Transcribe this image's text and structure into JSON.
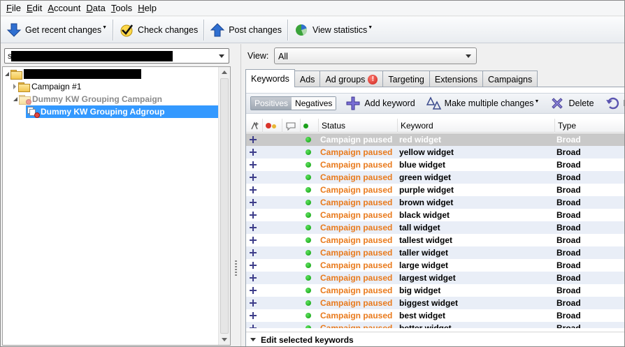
{
  "menu": [
    {
      "key": "F",
      "rest": "ile"
    },
    {
      "key": "E",
      "rest": "dit"
    },
    {
      "key": "A",
      "rest": "ccount"
    },
    {
      "key": "D",
      "rest": "ata"
    },
    {
      "key": "T",
      "rest": "ools"
    },
    {
      "key": "H",
      "rest": "elp"
    }
  ],
  "toolbar": {
    "get_recent": "Get recent changes",
    "check": "Check changes",
    "post": "Post changes",
    "stats": "View statistics"
  },
  "account_combo": {
    "prefix": "s"
  },
  "tree": {
    "campaign1": "Campaign #1",
    "campaign2": "Dummy KW Grouping Campaign",
    "adgroup": "Dummy KW Grouping Adgroup"
  },
  "view": {
    "label": "View:",
    "value": "All"
  },
  "tabs": [
    "Keywords",
    "Ads",
    "Ad groups",
    "Targeting",
    "Extensions",
    "Campaigns"
  ],
  "subbar": {
    "positives": "Positives",
    "negatives": "Negatives",
    "add_keyword": "Add keyword",
    "make_changes": "Make multiple changes",
    "delete": "Delete",
    "revert": "R"
  },
  "grid": {
    "headers": {
      "status": "Status",
      "keyword": "Keyword",
      "type": "Type"
    },
    "rows": [
      {
        "status": "Campaign paused",
        "keyword": "red widget",
        "type": "Broad"
      },
      {
        "status": "Campaign paused",
        "keyword": "yellow widget",
        "type": "Broad"
      },
      {
        "status": "Campaign paused",
        "keyword": "blue widget",
        "type": "Broad"
      },
      {
        "status": "Campaign paused",
        "keyword": "green widget",
        "type": "Broad"
      },
      {
        "status": "Campaign paused",
        "keyword": "purple widget",
        "type": "Broad"
      },
      {
        "status": "Campaign paused",
        "keyword": "brown widget",
        "type": "Broad"
      },
      {
        "status": "Campaign paused",
        "keyword": "black widget",
        "type": "Broad"
      },
      {
        "status": "Campaign paused",
        "keyword": "tall widget",
        "type": "Broad"
      },
      {
        "status": "Campaign paused",
        "keyword": "tallest widget",
        "type": "Broad"
      },
      {
        "status": "Campaign paused",
        "keyword": "taller widget",
        "type": "Broad"
      },
      {
        "status": "Campaign paused",
        "keyword": "large widget",
        "type": "Broad"
      },
      {
        "status": "Campaign paused",
        "keyword": "largest widget",
        "type": "Broad"
      },
      {
        "status": "Campaign paused",
        "keyword": "big widget",
        "type": "Broad"
      },
      {
        "status": "Campaign paused",
        "keyword": "biggest widget",
        "type": "Broad"
      },
      {
        "status": "Campaign paused",
        "keyword": "best widget",
        "type": "Broad"
      },
      {
        "status": "Campaign paused",
        "keyword": "better widget",
        "type": "Broad"
      }
    ]
  },
  "footer": {
    "label": "Edit selected keywords"
  },
  "colors": {
    "status_paused": "#e97a1c",
    "selection": "#3399ff",
    "alt_row": "#e9eef7"
  }
}
